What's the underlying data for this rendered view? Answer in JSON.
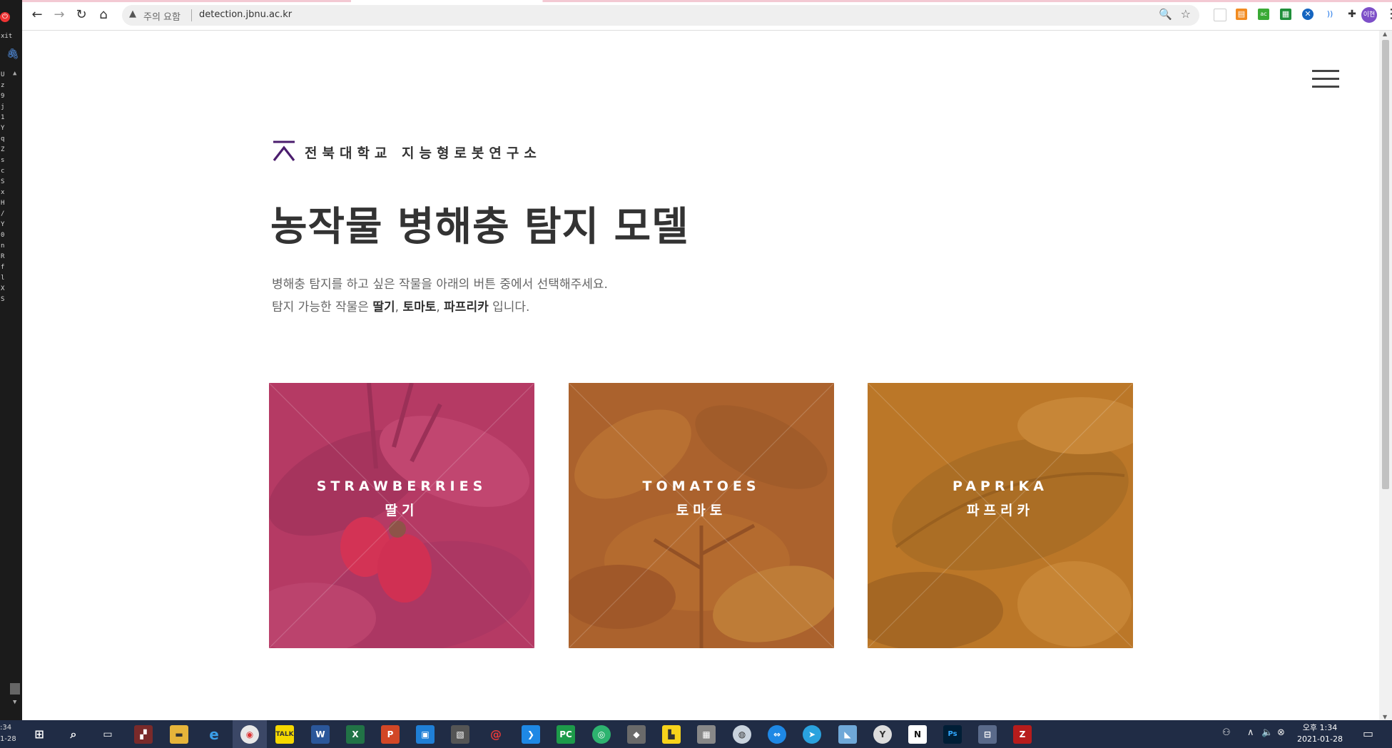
{
  "left_strip": {
    "exit_label": "xit",
    "letters": [
      "U",
      "z",
      "9",
      "j",
      "1",
      "Y",
      "q",
      "Z",
      "s",
      "c",
      "S",
      "x",
      "H",
      "/",
      "Y",
      "0",
      "n",
      "R",
      "f",
      "l",
      "X",
      "S"
    ]
  },
  "browser": {
    "security_label": "주의 요함",
    "url": "detection.jbnu.ac.kr",
    "profile_label": "이현"
  },
  "page": {
    "brand_text": "전북대학교 지능형로봇연구소",
    "title": "농작물 병해충 탐지 모델",
    "intro_line1": "병해충 탐지를 하고 싶은 작물을 아래의 버튼 중에서 선택해주세요.",
    "intro_line2_prefix": "탐지 가능한 작물은 ",
    "crop1": "딸기",
    "comma1": ", ",
    "crop2": "토마토",
    "comma2": ", ",
    "crop3": "파프리카",
    "intro_line2_suffix": " 입니다.",
    "cards": [
      {
        "title": "STRAWBERRIES",
        "subtitle": "딸기",
        "tint": "#c23a6a"
      },
      {
        "title": "TOMATOES",
        "subtitle": "토마토",
        "tint": "#b8662f"
      },
      {
        "title": "PAPRIKA",
        "subtitle": "파프리카",
        "tint": "#c27a22"
      }
    ]
  },
  "taskbar": {
    "left_time_1": ":34",
    "left_time_2": "1-28",
    "time": "오후 1:34",
    "date": "2021-01-28"
  }
}
